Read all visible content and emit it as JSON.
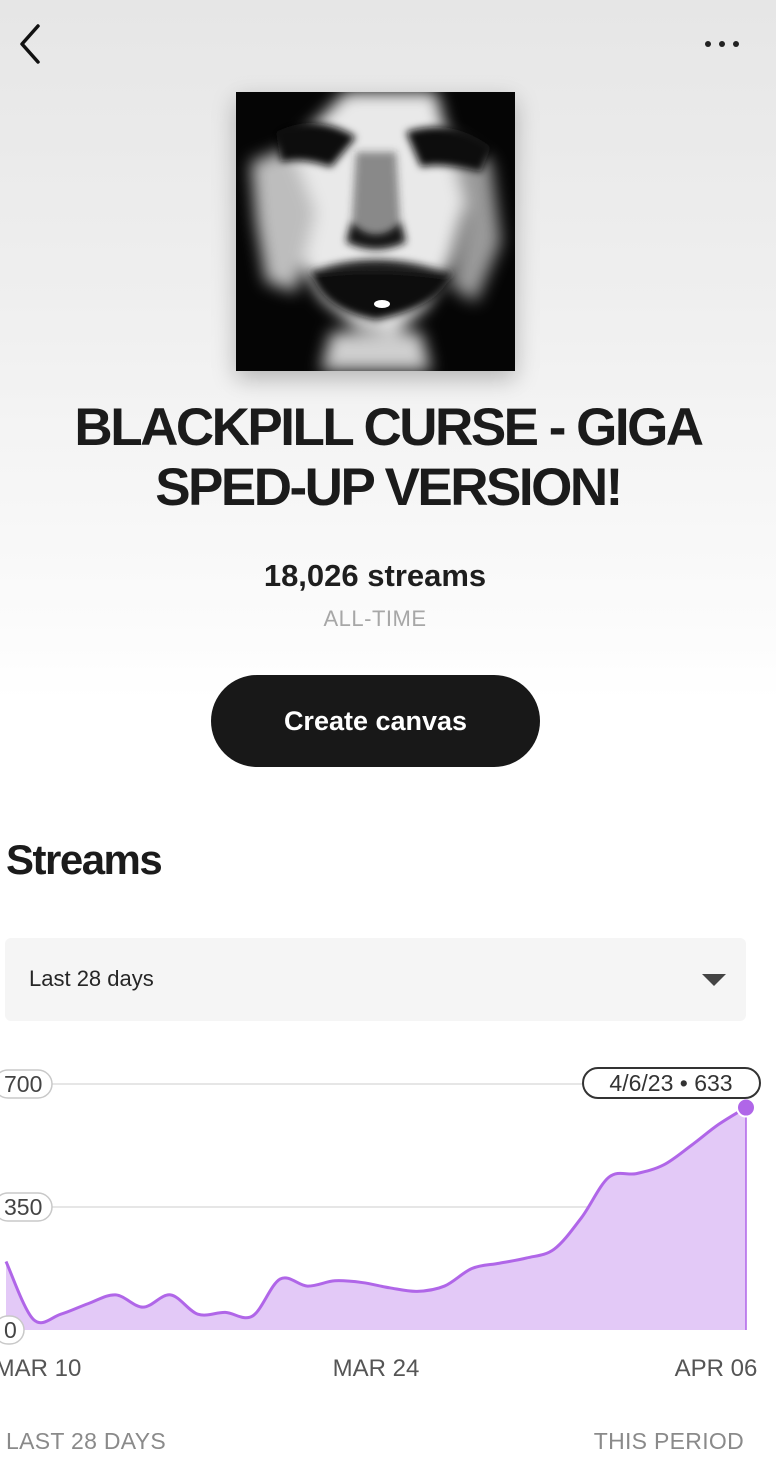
{
  "header": {
    "back_icon": "chevron-left-icon",
    "more_icon": "more-horizontal-icon"
  },
  "track": {
    "title_line1": "BLACKPILL CURSE - GIGA",
    "title_line2": "SPED-UP VERSION!",
    "streams_total": "18,026 streams",
    "streams_caption": "ALL-TIME",
    "cta_label": "Create canvas"
  },
  "streams_section": {
    "heading": "Streams",
    "range_select": {
      "selected": "Last 28 days"
    }
  },
  "chart_data": {
    "type": "area",
    "color": "#b066e8",
    "fill_color": "#e3c9f7",
    "grid": true,
    "ylim": [
      0,
      700
    ],
    "y_ticks": [
      "700",
      "350",
      "0"
    ],
    "x_ticks": [
      "MAR 10",
      "MAR 24",
      "APR 06"
    ],
    "x": [
      "3/10",
      "3/11",
      "3/12",
      "3/13",
      "3/14",
      "3/15",
      "3/16",
      "3/17",
      "3/18",
      "3/19",
      "3/20",
      "3/21",
      "3/22",
      "3/23",
      "3/24",
      "3/25",
      "3/26",
      "3/27",
      "3/28",
      "3/29",
      "3/30",
      "3/31",
      "4/1",
      "4/2",
      "4/3",
      "4/4",
      "4/5",
      "4/6"
    ],
    "values": [
      195,
      30,
      45,
      75,
      100,
      65,
      100,
      45,
      50,
      40,
      145,
      125,
      140,
      135,
      120,
      110,
      125,
      175,
      190,
      205,
      230,
      320,
      435,
      445,
      470,
      525,
      585,
      633
    ],
    "tooltip": "4/6/23 • 633",
    "footer_left": "LAST 28 DAYS",
    "footer_right": "THIS PERIOD"
  }
}
